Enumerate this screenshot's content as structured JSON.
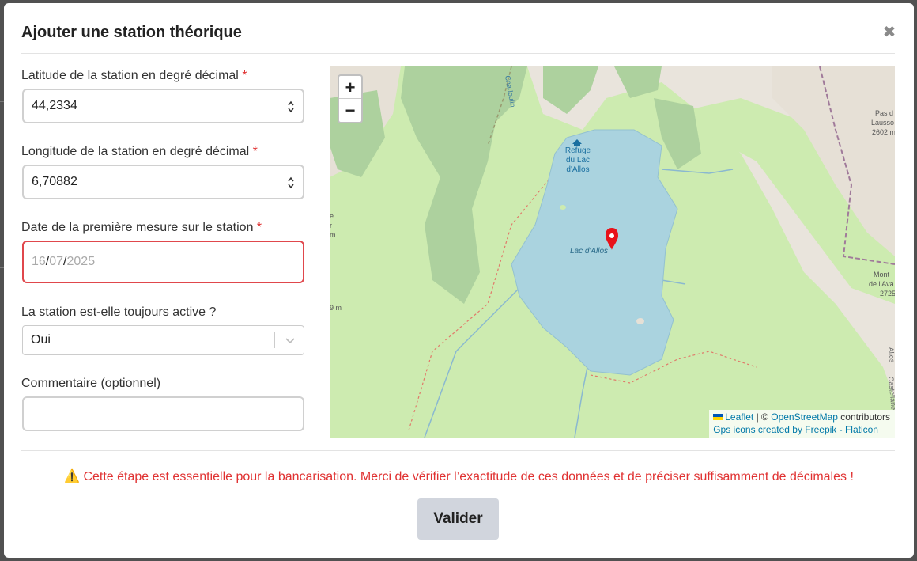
{
  "modal": {
    "title": "Ajouter une station théorique",
    "close_icon": "close-icon"
  },
  "fields": {
    "latitude": {
      "label": "Latitude de la station en degré décimal",
      "required": "*",
      "value": "44,2334"
    },
    "longitude": {
      "label": "Longitude de la station en degré décimal",
      "required": "*",
      "value": "6,70882"
    },
    "date": {
      "label": "Date de la première mesure sur le station",
      "required": "*",
      "day": "16",
      "month": "07",
      "year": "2025",
      "sep": "/"
    },
    "active": {
      "label": "La station est-elle toujours active ?",
      "selected": "Oui"
    },
    "comment": {
      "label": "Commentaire (optionnel)",
      "value": ""
    }
  },
  "map": {
    "zoom_in": "+",
    "zoom_out": "−",
    "labels": {
      "refuge": [
        "Refuge",
        "du Lac",
        "d'Allos"
      ],
      "lake": "Lac d'Allos",
      "pas": [
        "Pas d",
        "Lausso",
        "2602 m"
      ],
      "mont": [
        "Mont",
        "de l'Ava",
        "2725"
      ],
      "creek": "Chadoulin",
      "left_e": "e",
      "left_r": "r",
      "left_m": "m",
      "left_9m": "9 m",
      "allos": "Allos",
      "castellane": "Castellane"
    },
    "attribution": {
      "leaflet": "Leaflet",
      "sep": "| ©",
      "osm": "OpenStreetMap",
      "contributors": "contributors",
      "gps": "Gps icons created by Freepik - Flaticon"
    },
    "colors": {
      "lake": "#aad3df",
      "forest": "#add19e",
      "grass": "#cdebb0",
      "rock": "#e9e4dc",
      "marker": "#e8121a"
    }
  },
  "warning": {
    "icon": "⚠️",
    "text": "Cette étape est essentielle pour la bancarisation. Merci de vérifier l’exactitude de ces données et de préciser suffisamment de décimales !"
  },
  "submit_label": "Valider"
}
